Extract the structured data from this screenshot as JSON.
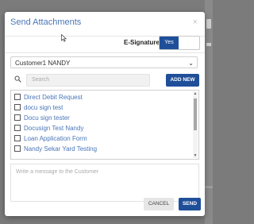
{
  "modal": {
    "title": "Send Attachments",
    "close_glyph": "×"
  },
  "esignature": {
    "label": "E-Signature",
    "toggle_value": "Yes"
  },
  "customer_select": {
    "selected": "Customer1 NANDY"
  },
  "search": {
    "placeholder": "Search",
    "add_new_label": "ADD NEW"
  },
  "documents": [
    {
      "label": "Direct Debit Request"
    },
    {
      "label": "docu sign test"
    },
    {
      "label": "Docu sign tester"
    },
    {
      "label": "Docusign Test Nandy"
    },
    {
      "label": "Loan Application Form"
    },
    {
      "label": "Nandy Sekar Yard Testing"
    }
  ],
  "message": {
    "placeholder": "Write a message to the Customer"
  },
  "actions": {
    "cancel_label": "CANCEL",
    "send_label": "SEND"
  },
  "colors": {
    "primary": "#1f4f99",
    "link": "#4a76b8"
  }
}
